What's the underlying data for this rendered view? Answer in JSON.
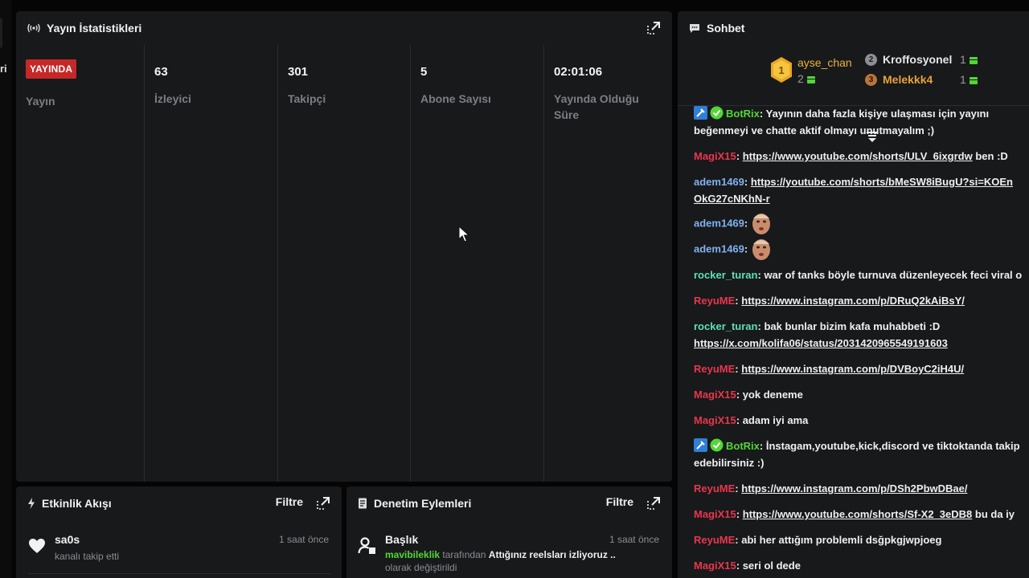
{
  "left_sliver": {
    "text": "ri"
  },
  "stats": {
    "title": "Yayın İstatistikleri",
    "live_badge": "YAYINDA",
    "live_label": "Yayın",
    "columns": [
      {
        "value": "63",
        "label": "İzleyici"
      },
      {
        "value": "301",
        "label": "Takipçi"
      },
      {
        "value": "5",
        "label": "Abone Sayısı"
      },
      {
        "value": "02:01:06",
        "label": "Yayında Olduğu Süre"
      }
    ]
  },
  "activity": {
    "title": "Etkinlik Akışı",
    "filter_label": "Filtre",
    "item": {
      "name": "sa0s",
      "sub": "kanalı takip etti",
      "time": "1 saat önce"
    }
  },
  "moderation": {
    "title": "Denetim Eylemleri",
    "filter_label": "Filtre",
    "item": {
      "name": "Başlık",
      "time": "1 saat önce",
      "actor": "mavibileklik",
      "by_text": "tarafından",
      "value": "Attığınız reelsları izliyoruz ..",
      "suffix": "olarak değiştirildi"
    }
  },
  "chat": {
    "title": "Sohbet",
    "leaderboard": {
      "first": {
        "rank": "1",
        "name": "ayse_chan",
        "count": "2"
      },
      "others": [
        {
          "rank": "2",
          "name": "Kroffosyonel",
          "count": "1",
          "color": "#e8e8e8",
          "rank_bg": "#8c8f94"
        },
        {
          "rank": "3",
          "name": "Melekkk4",
          "count": "1",
          "color": "#e8a13c",
          "rank_bg": "#b8763a"
        }
      ]
    },
    "messages": [
      {
        "user": "BotRix",
        "color": "#53d636",
        "badges": true,
        "text": "Yayının daha fazla kişiye ulaşması için yayını beğenmeyi ve chatte aktif olmayı unutmayalım ;)"
      },
      {
        "user": "MagiX15",
        "color": "#e8364e",
        "link": "https://www.youtube.com/shorts/ULV_6ixgrdw",
        "after": "ben :D"
      },
      {
        "user": "adem1469",
        "color": "#7fb2f0",
        "link": "https://youtube.com/shorts/bMeSW8iBugU?si=KOEnOkG27cNKhN-r"
      },
      {
        "user": "adem1469",
        "color": "#7fb2f0",
        "emote": "face-emote"
      },
      {
        "user": "adem1469",
        "color": "#7fb2f0",
        "emote": "face-emote"
      },
      {
        "user": "rocker_turan",
        "color": "#5de0b4",
        "text": "war of tanks böyle turnuva düzenleyecek feci viral o"
      },
      {
        "user": "ReyuME",
        "color": "#e8364e",
        "link": "https://www.instagram.com/p/DRuQ2kAiBsY/"
      },
      {
        "user": "rocker_turan",
        "color": "#5de0b4",
        "text": "bak bunlar bizim kafa muhabbeti :D",
        "link2": "https://x.com/kolifa06/status/2031420965549191603"
      },
      {
        "user": "ReyuME",
        "color": "#e8364e",
        "link": "https://www.instagram.com/p/DVBoyC2iH4U/"
      },
      {
        "user": "MagiX15",
        "color": "#e8364e",
        "text": "yok deneme"
      },
      {
        "user": "MagiX15",
        "color": "#e8364e",
        "text": "adam iyi ama"
      },
      {
        "user": "BotRix",
        "color": "#53d636",
        "badges": true,
        "text": "İnstagam,youtube,kick,discord ve tiktoktanda takip edebilirsiniz :)"
      },
      {
        "user": "ReyuME",
        "color": "#e8364e",
        "link": "https://www.instagram.com/p/DSh2PbwDBae/"
      },
      {
        "user": "MagiX15",
        "color": "#e8364e",
        "link": "https://www.youtube.com/shorts/Sf-X2_3eDB8",
        "after": "bu da iy"
      },
      {
        "user": "ReyuME",
        "color": "#e8364e",
        "text": "abi her attığım problemli dsğpkgjwpjoeg"
      },
      {
        "user": "MagiX15",
        "color": "#e8364e",
        "text": "seri ol dede"
      }
    ]
  }
}
